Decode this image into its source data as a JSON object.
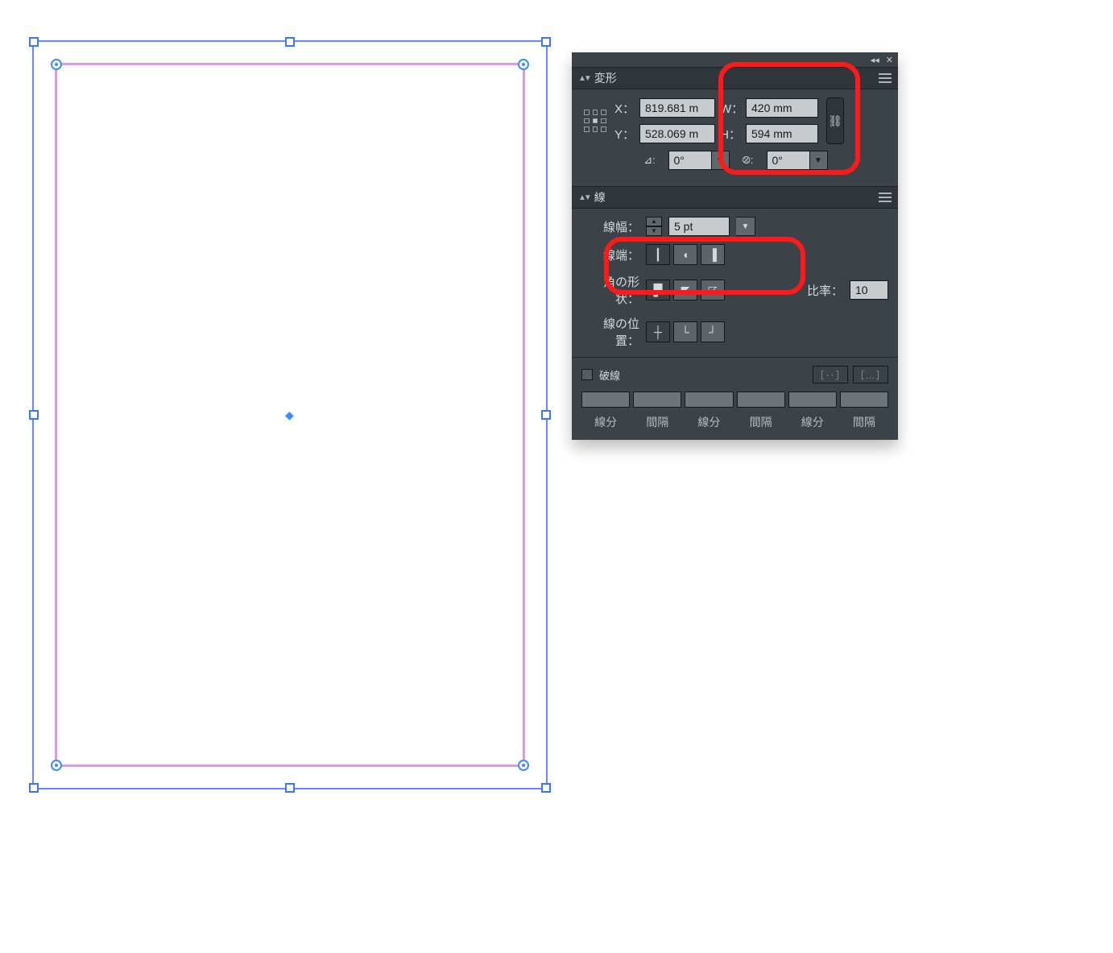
{
  "transform_panel": {
    "title": "変形",
    "x_label": "X：",
    "y_label": "Y：",
    "w_label": "W：",
    "h_label": "H：",
    "x_value": "819.681 m",
    "y_value": "528.069 m",
    "w_value": "420 mm",
    "h_value": "594 mm",
    "angle_icon": "⊿:",
    "angle_value": "0°",
    "shear_icon": "⦼:",
    "shear_value": "0°"
  },
  "stroke_panel": {
    "title": "線",
    "weight_label": "線幅：",
    "weight_value": "5 pt",
    "cap_label": "線端：",
    "join_label": "角の形状：",
    "ratio_label": "比率：",
    "ratio_value": "10",
    "align_label": "線の位置：",
    "dashed_label": "破線",
    "dash_cols": [
      "線分",
      "間隔",
      "線分",
      "間隔",
      "線分",
      "間隔"
    ]
  },
  "icons": {
    "link": "⛓",
    "collapse": "◂◂",
    "close": "✕",
    "dropdown": "▼",
    "up": "▲",
    "down": "▼",
    "cap_butt": "┃",
    "cap_round": "◖",
    "cap_projecting": "▐",
    "join_miter": "▛",
    "join_round": "◤",
    "join_bevel": "◸",
    "align_center": "┼",
    "align_inside": "└",
    "align_outside": "┘",
    "dash_preserve": "［‥］",
    "dash_adjust": "［…］",
    "center_mark": "◆"
  }
}
